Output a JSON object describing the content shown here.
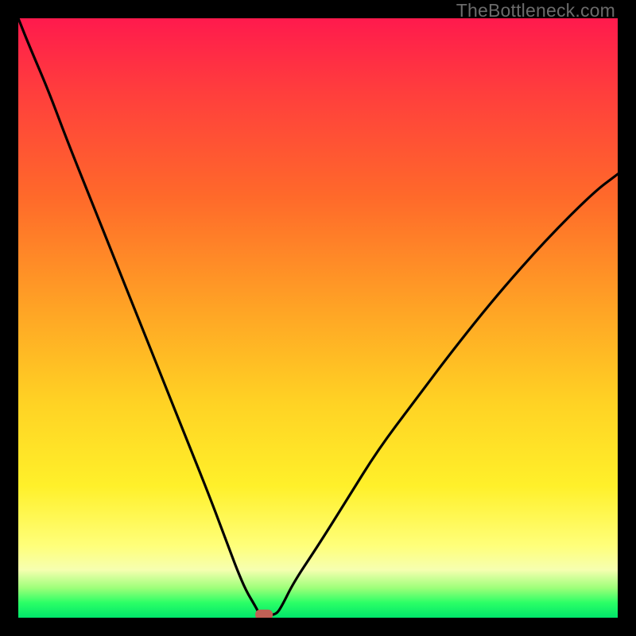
{
  "attribution": "TheBottleneck.com",
  "colors": {
    "frame": "#000000",
    "curve": "#000000",
    "marker": "#c06055",
    "gradient_top": "#ff1a4d",
    "gradient_mid": "#ffd224",
    "gradient_bottom": "#00e56a"
  },
  "chart_data": {
    "type": "line",
    "title": "",
    "xlabel": "",
    "ylabel": "",
    "xlim": [
      0,
      100
    ],
    "ylim": [
      0,
      100
    ],
    "x": [
      0,
      2,
      5,
      8,
      12,
      16,
      20,
      24,
      28,
      32,
      35,
      36.5,
      38,
      39.5,
      40.3,
      41.5,
      43,
      44,
      46,
      50,
      55,
      60,
      66,
      72,
      80,
      88,
      96,
      100
    ],
    "y": [
      100,
      95,
      88,
      80,
      70,
      60,
      50,
      40,
      30,
      20,
      12,
      8,
      4.5,
      2,
      0.5,
      0.5,
      0.5,
      2,
      6,
      12,
      20,
      28,
      36,
      44,
      54,
      63,
      71,
      74
    ],
    "marker": {
      "x": 41.0,
      "y": 0.5
    },
    "annotations": []
  }
}
